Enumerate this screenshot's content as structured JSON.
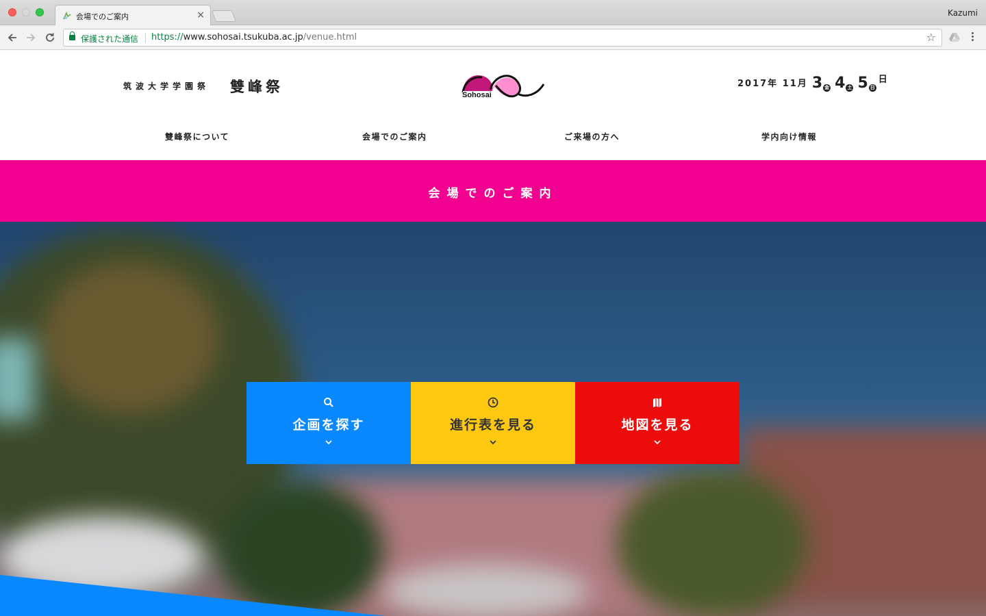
{
  "browser": {
    "tab_title": "会場でのご案内",
    "tab_close": "×",
    "profile_name": "Kazumi",
    "secure_label": "保護された通信",
    "url_scheme": "https://",
    "url_host": "www.sohosai.tsukuba.ac.jp",
    "url_path": "/venue.html",
    "back_icon": "arrow-left-icon",
    "forward_icon": "arrow-right-icon",
    "reload_icon": "reload-icon",
    "star_icon": "star-icon"
  },
  "header": {
    "university": "筑波大学学園祭",
    "festival_name": "雙峰祭",
    "logo_text": "Sohosai",
    "date_year_month": "2017年 11月",
    "days": [
      {
        "num": "3",
        "weekday": "金"
      },
      {
        "num": "4",
        "weekday": "土"
      },
      {
        "num": "5",
        "weekday": "日"
      }
    ],
    "date_suffix": "日"
  },
  "nav": {
    "items": [
      {
        "label": "雙峰祭について"
      },
      {
        "label": "会場でのご案内"
      },
      {
        "label": "ご来場の方へ"
      },
      {
        "label": "学内向け情報"
      }
    ]
  },
  "page": {
    "title": "会場でのご案内"
  },
  "tiles": [
    {
      "label": "企画を探す",
      "icon": "search-icon",
      "color": "#0a88ff"
    },
    {
      "label": "進行表を見る",
      "icon": "clock-icon",
      "color": "#fec80e"
    },
    {
      "label": "地図を見る",
      "icon": "map-icon",
      "color": "#ec0c0c"
    }
  ],
  "colors": {
    "brand_pink": "#f20190",
    "tile_blue": "#0a88ff",
    "tile_yellow": "#fec80e",
    "tile_red": "#ec0c0c"
  }
}
